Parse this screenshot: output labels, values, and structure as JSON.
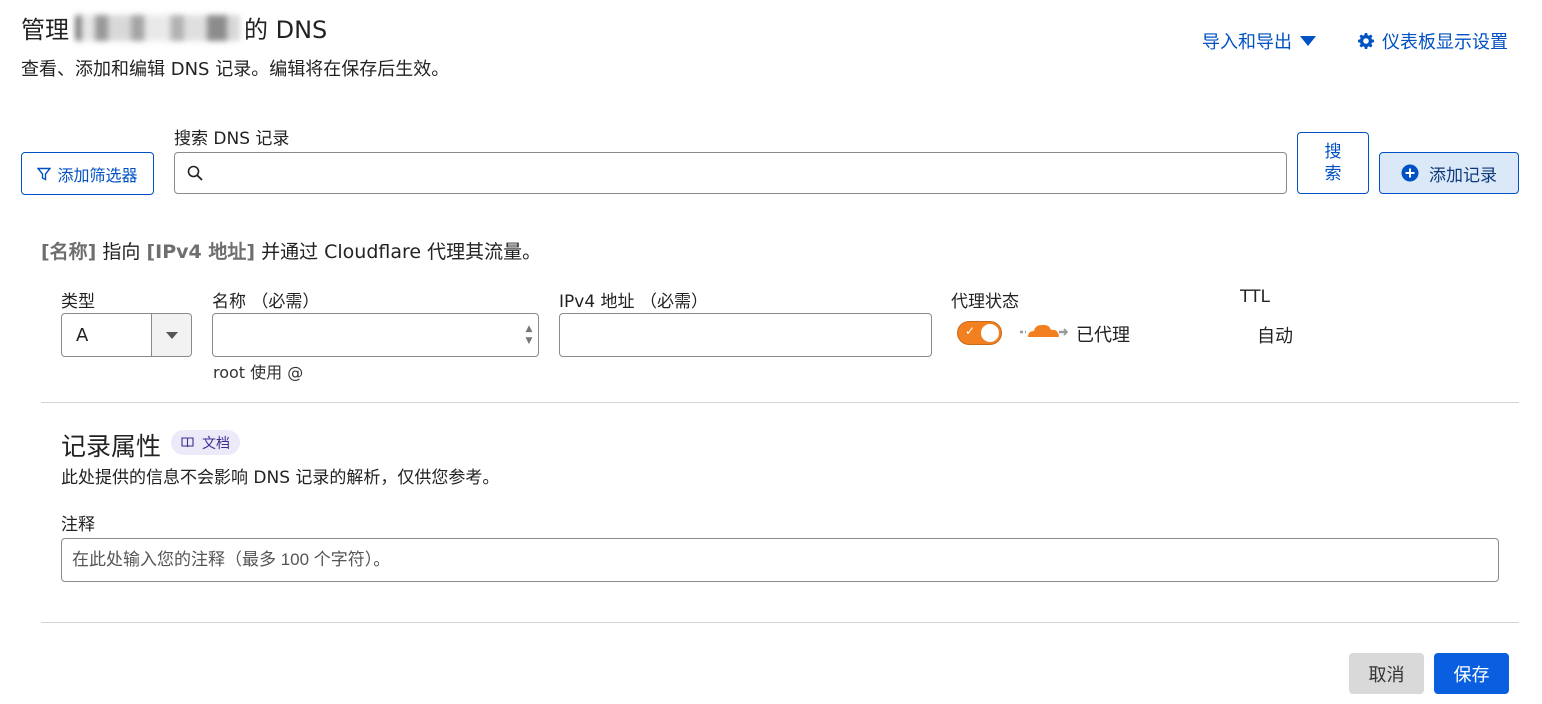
{
  "header": {
    "title_prefix": "管理",
    "title_suffix": "的 DNS",
    "subtitle": "查看、添加和编辑 DNS 记录。编辑将在保存后生效。",
    "import_export": "导入和导出",
    "dashboard_settings": "仪表板显示设置"
  },
  "toolbar": {
    "add_filter": "添加筛选器",
    "search_label": "搜索 DNS 记录",
    "search_value": "",
    "search_button": "搜索",
    "add_record": "添加记录"
  },
  "form": {
    "summary": {
      "name_token": "[名称]",
      "text1": " 指向 ",
      "ipv4_token": "[IPv4 地址]",
      "text2": " 并通过 Cloudflare 代理其流量。"
    },
    "type_label": "类型",
    "type_value": "A",
    "name_label": "名称 （必需）",
    "name_value": "",
    "name_hint": "root 使用 @",
    "ipv4_label": "IPv4 地址 （必需）",
    "ipv4_value": "",
    "proxy_label": "代理状态",
    "proxy_status": "已代理",
    "proxy_enabled": true,
    "ttl_label": "TTL",
    "ttl_value": "自动"
  },
  "attributes": {
    "title": "记录属性",
    "docs_badge": "文档",
    "description": "此处提供的信息不会影响 DNS 记录的解析，仅供您参考。",
    "note_label": "注释",
    "note_placeholder": "在此处输入您的注释（最多 100 个字符）。",
    "note_value": ""
  },
  "actions": {
    "cancel": "取消",
    "save": "保存"
  },
  "colors": {
    "link": "#0051c3",
    "proxy_orange": "#f38020",
    "save_blue": "#0a5fe0"
  }
}
